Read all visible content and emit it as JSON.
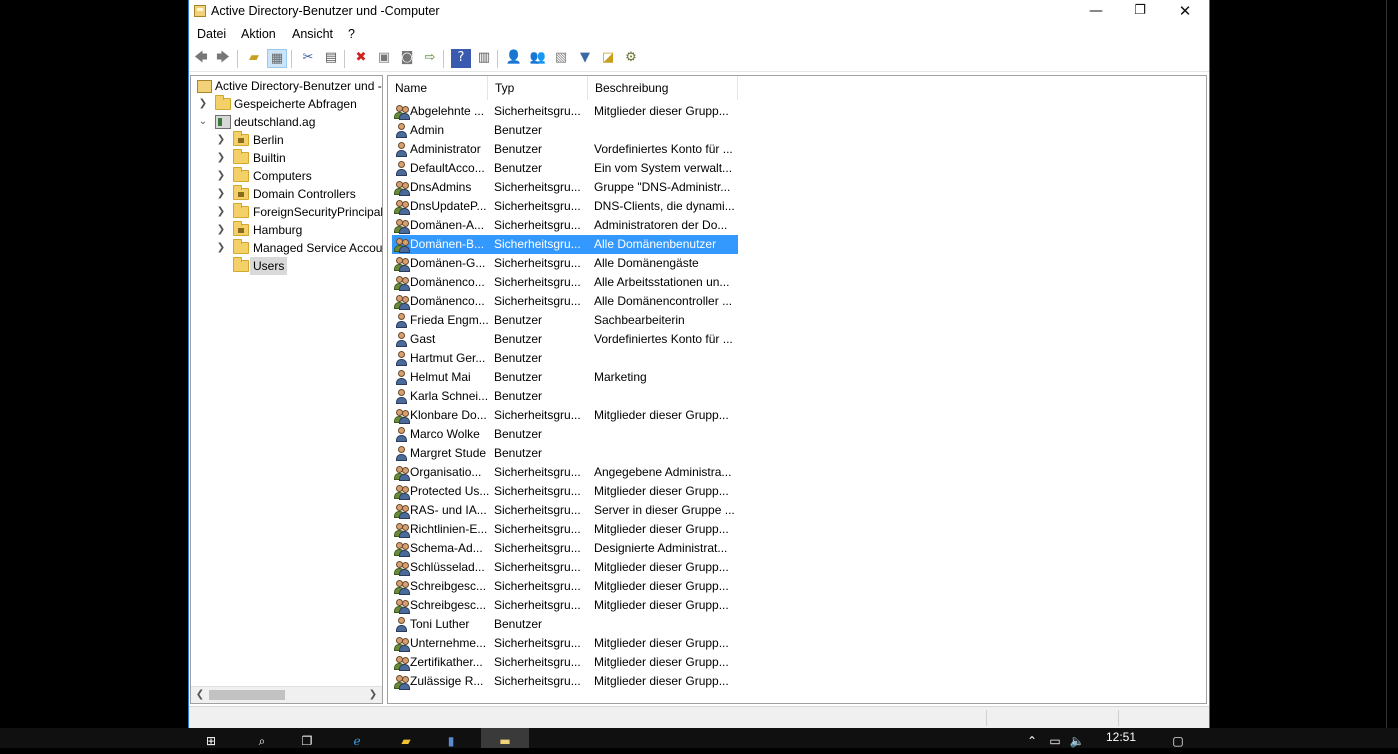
{
  "window": {
    "title": "Active Directory-Benutzer und -Computer",
    "minimize": "—",
    "restore": "❐",
    "close": "✕"
  },
  "menu": [
    "Datei",
    "Aktion",
    "Ansicht",
    "?"
  ],
  "toolbar_icons": [
    "back-icon",
    "forward-icon",
    "up-folder-icon",
    "show-hide-tree-icon",
    "cut-icon",
    "copy-icon",
    "delete-icon",
    "properties-icon",
    "refresh-icon",
    "export-icon",
    "help-icon",
    "console-icon",
    "new-user-icon",
    "new-group-icon",
    "new-ou-icon",
    "filter-icon",
    "find-icon",
    "delegate-icon"
  ],
  "tree": {
    "root": "Active Directory-Benutzer und -",
    "saved_queries": "Gespeicherte Abfragen",
    "domain": "deutschland.ag",
    "children": [
      "Berlin",
      "Builtin",
      "Computers",
      "Domain Controllers",
      "ForeignSecurityPrincipals",
      "Hamburg",
      "Managed Service Accounts",
      "Users"
    ]
  },
  "columns": {
    "name": "Name",
    "type": "Typ",
    "description": "Beschreibung"
  },
  "rows": [
    {
      "name": "Abgelehnte ...",
      "type": "Sicherheitsgru...",
      "desc": "Mitglieder dieser Grupp...",
      "kind": "group"
    },
    {
      "name": "Admin",
      "type": "Benutzer",
      "desc": "",
      "kind": "user"
    },
    {
      "name": "Administrator",
      "type": "Benutzer",
      "desc": "Vordefiniertes Konto für ...",
      "kind": "user"
    },
    {
      "name": "DefaultAcco...",
      "type": "Benutzer",
      "desc": "Ein vom System verwalt...",
      "kind": "user"
    },
    {
      "name": "DnsAdmins",
      "type": "Sicherheitsgru...",
      "desc": "Gruppe \"DNS-Administr...",
      "kind": "group"
    },
    {
      "name": "DnsUpdateP...",
      "type": "Sicherheitsgru...",
      "desc": "DNS-Clients, die dynami...",
      "kind": "group"
    },
    {
      "name": "Domänen-A...",
      "type": "Sicherheitsgru...",
      "desc": "Administratoren der Do...",
      "kind": "group"
    },
    {
      "name": "Domänen-B...",
      "type": "Sicherheitsgru...",
      "desc": "Alle Domänenbenutzer",
      "kind": "group"
    },
    {
      "name": "Domänen-G...",
      "type": "Sicherheitsgru...",
      "desc": "Alle Domänengäste",
      "kind": "group"
    },
    {
      "name": "Domänenco...",
      "type": "Sicherheitsgru...",
      "desc": "Alle Arbeitsstationen un...",
      "kind": "group"
    },
    {
      "name": "Domänenco...",
      "type": "Sicherheitsgru...",
      "desc": "Alle Domänencontroller ...",
      "kind": "group"
    },
    {
      "name": "Frieda Engm...",
      "type": "Benutzer",
      "desc": "Sachbearbeiterin",
      "kind": "user"
    },
    {
      "name": "Gast",
      "type": "Benutzer",
      "desc": "Vordefiniertes Konto für ...",
      "kind": "user"
    },
    {
      "name": "Hartmut Ger...",
      "type": "Benutzer",
      "desc": "",
      "kind": "user"
    },
    {
      "name": "Helmut Mai",
      "type": "Benutzer",
      "desc": "Marketing",
      "kind": "user"
    },
    {
      "name": "Karla Schnei...",
      "type": "Benutzer",
      "desc": "",
      "kind": "user"
    },
    {
      "name": "Klonbare Do...",
      "type": "Sicherheitsgru...",
      "desc": "Mitglieder dieser Grupp...",
      "kind": "group"
    },
    {
      "name": "Marco Wolke",
      "type": "Benutzer",
      "desc": "",
      "kind": "user"
    },
    {
      "name": "Margret Stude",
      "type": "Benutzer",
      "desc": "",
      "kind": "user"
    },
    {
      "name": "Organisatio...",
      "type": "Sicherheitsgru...",
      "desc": "Angegebene Administra...",
      "kind": "group"
    },
    {
      "name": "Protected Us...",
      "type": "Sicherheitsgru...",
      "desc": "Mitglieder dieser Grupp...",
      "kind": "group"
    },
    {
      "name": "RAS- und IA...",
      "type": "Sicherheitsgru...",
      "desc": "Server in dieser Gruppe ...",
      "kind": "group"
    },
    {
      "name": "Richtlinien-E...",
      "type": "Sicherheitsgru...",
      "desc": "Mitglieder dieser Grupp...",
      "kind": "group"
    },
    {
      "name": "Schema-Ad...",
      "type": "Sicherheitsgru...",
      "desc": "Designierte Administrat...",
      "kind": "group"
    },
    {
      "name": "Schlüsselad...",
      "type": "Sicherheitsgru...",
      "desc": "Mitglieder dieser Grupp...",
      "kind": "group"
    },
    {
      "name": "Schreibgesc...",
      "type": "Sicherheitsgru...",
      "desc": "Mitglieder dieser Grupp...",
      "kind": "group"
    },
    {
      "name": "Schreibgesc...",
      "type": "Sicherheitsgru...",
      "desc": "Mitglieder dieser Grupp...",
      "kind": "group"
    },
    {
      "name": "Toni Luther",
      "type": "Benutzer",
      "desc": "",
      "kind": "user"
    },
    {
      "name": "Unternehme...",
      "type": "Sicherheitsgru...",
      "desc": "Mitglieder dieser Grupp...",
      "kind": "group"
    },
    {
      "name": "Zertifikather...",
      "type": "Sicherheitsgru...",
      "desc": "Mitglieder dieser Grupp...",
      "kind": "group"
    },
    {
      "name": "Zulässige R...",
      "type": "Sicherheitsgru...",
      "desc": "Mitglieder dieser Grupp...",
      "kind": "group"
    }
  ],
  "selected_row": 7,
  "taskbar": {
    "clock": "12:51"
  },
  "colors": {
    "selection": "#3399ff",
    "accent": "#2b79d0"
  }
}
